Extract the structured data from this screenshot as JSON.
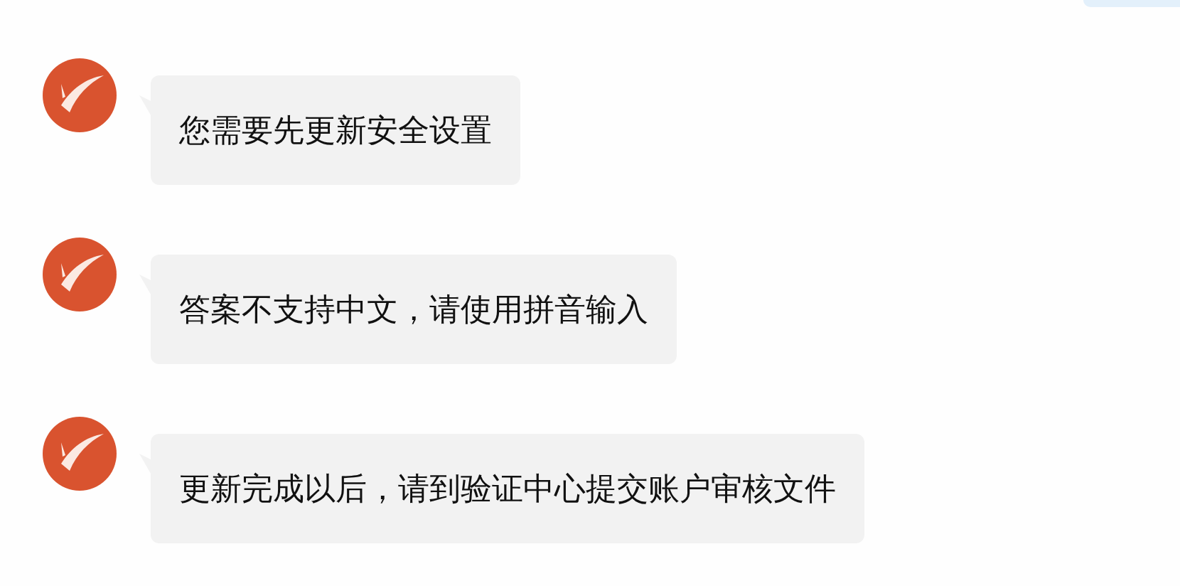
{
  "messages": [
    {
      "text": "您需要先更新安全设置"
    },
    {
      "text": "答案不支持中文，请使用拼音输入"
    },
    {
      "text": "更新完成以后，请到验证中心提交账户审核文件"
    }
  ]
}
